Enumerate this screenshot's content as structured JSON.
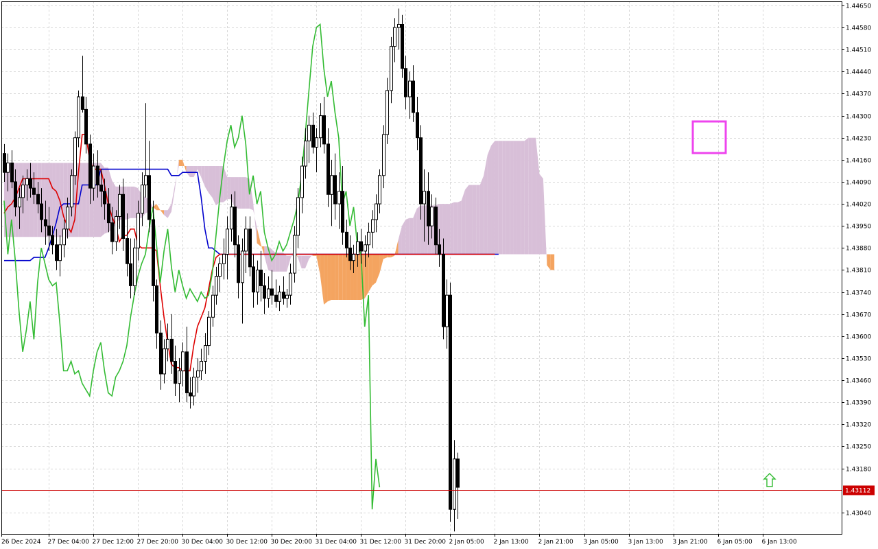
{
  "chart_data": {
    "type": "candlestick",
    "title": "",
    "x_labels": [
      "26 Dec 2024",
      "27 Dec 04:00",
      "27 Dec 12:00",
      "27 Dec 20:00",
      "30 Dec 04:00",
      "30 Dec 12:00",
      "30 Dec 20:00",
      "31 Dec 04:00",
      "31 Dec 12:00",
      "31 Dec 20:00",
      "2 Jan 05:00",
      "2 Jan 13:00",
      "2 Jan 21:00",
      "3 Jan 05:00",
      "3 Jan 13:00",
      "3 Jan 21:00",
      "6 Jan 05:00",
      "6 Jan 13:00"
    ],
    "y_labels": [
      "1.44650",
      "1.44580",
      "1.44510",
      "1.44440",
      "1.44370",
      "1.44300",
      "1.44230",
      "1.44160",
      "1.44090",
      "1.44020",
      "1.43950",
      "1.43880",
      "1.43810",
      "1.43740",
      "1.43670",
      "1.43600",
      "1.43530",
      "1.43460",
      "1.43390",
      "1.43320",
      "1.43250",
      "1.43180",
      "1.43040"
    ],
    "ylim": [
      1.42972,
      1.44663
    ],
    "current_price": "1.43112",
    "current_price_value": 1.43112,
    "candles": [
      [
        1.4418,
        1.4421,
        1.4409,
        1.4412
      ],
      [
        1.4412,
        1.4418,
        1.4406,
        1.4415
      ],
      [
        1.4415,
        1.4419,
        1.4407,
        1.4409
      ],
      [
        1.4409,
        1.4413,
        1.4398,
        1.4401
      ],
      [
        1.4401,
        1.4407,
        1.4394,
        1.4404
      ],
      [
        1.4404,
        1.4411,
        1.4399,
        1.4408
      ],
      [
        1.4408,
        1.4413,
        1.4403,
        1.441
      ],
      [
        1.441,
        1.4415,
        1.4404,
        1.4407
      ],
      [
        1.4407,
        1.4412,
        1.4402,
        1.4405
      ],
      [
        1.4405,
        1.4409,
        1.4399,
        1.4402
      ],
      [
        1.4402,
        1.4407,
        1.4393,
        1.4397
      ],
      [
        1.4397,
        1.4403,
        1.4389,
        1.4395
      ],
      [
        1.4395,
        1.4401,
        1.4387,
        1.4392
      ],
      [
        1.4392,
        1.4395,
        1.4386,
        1.4389
      ],
      [
        1.4389,
        1.4394,
        1.4381,
        1.4384
      ],
      [
        1.4384,
        1.4392,
        1.4379,
        1.4389
      ],
      [
        1.4389,
        1.4397,
        1.4385,
        1.4394
      ],
      [
        1.4394,
        1.4404,
        1.4391,
        1.4401
      ],
      [
        1.4401,
        1.4413,
        1.4398,
        1.4411
      ],
      [
        1.4411,
        1.4425,
        1.4408,
        1.4423
      ],
      [
        1.4423,
        1.4438,
        1.442,
        1.4436
      ],
      [
        1.4436,
        1.4449,
        1.4431,
        1.4432
      ],
      [
        1.4432,
        1.4436,
        1.4418,
        1.4421
      ],
      [
        1.4421,
        1.4424,
        1.4402,
        1.4407
      ],
      [
        1.4407,
        1.4418,
        1.4403,
        1.4414
      ],
      [
        1.4414,
        1.4419,
        1.4404,
        1.4408
      ],
      [
        1.4408,
        1.4413,
        1.4401,
        1.4406
      ],
      [
        1.4406,
        1.441,
        1.4397,
        1.4402
      ],
      [
        1.4402,
        1.4407,
        1.4393,
        1.4396
      ],
      [
        1.4396,
        1.4401,
        1.4386,
        1.439
      ],
      [
        1.439,
        1.44,
        1.4387,
        1.4398
      ],
      [
        1.4398,
        1.4408,
        1.4394,
        1.4405
      ],
      [
        1.4405,
        1.441,
        1.4387,
        1.4391
      ],
      [
        1.4391,
        1.4399,
        1.4379,
        1.4383
      ],
      [
        1.4383,
        1.4391,
        1.4372,
        1.4376
      ],
      [
        1.4376,
        1.4391,
        1.4373,
        1.4388
      ],
      [
        1.4388,
        1.4403,
        1.4384,
        1.4399
      ],
      [
        1.4399,
        1.4412,
        1.4395,
        1.4408
      ],
      [
        1.4408,
        1.4434,
        1.4404,
        1.4411
      ],
      [
        1.4411,
        1.4422,
        1.4393,
        1.4397
      ],
      [
        1.4397,
        1.4403,
        1.4371,
        1.4376
      ],
      [
        1.4376,
        1.4378,
        1.4356,
        1.4361
      ],
      [
        1.4361,
        1.4365,
        1.4343,
        1.4348
      ],
      [
        1.4348,
        1.4359,
        1.4345,
        1.4356
      ],
      [
        1.4356,
        1.4364,
        1.4352,
        1.4359
      ],
      [
        1.4359,
        1.4367,
        1.4348,
        1.4352
      ],
      [
        1.4352,
        1.4357,
        1.4341,
        1.4345
      ],
      [
        1.4345,
        1.4353,
        1.4339,
        1.4349
      ],
      [
        1.4349,
        1.4358,
        1.4344,
        1.4355
      ],
      [
        1.4355,
        1.4363,
        1.4339,
        1.4342
      ],
      [
        1.4342,
        1.4347,
        1.4337,
        1.4341
      ],
      [
        1.4341,
        1.435,
        1.4338,
        1.4347
      ],
      [
        1.4347,
        1.4353,
        1.4342,
        1.4349
      ],
      [
        1.4349,
        1.4356,
        1.4346,
        1.4352
      ],
      [
        1.4352,
        1.4361,
        1.4348,
        1.4357
      ],
      [
        1.4357,
        1.4368,
        1.4354,
        1.4366
      ],
      [
        1.4366,
        1.4376,
        1.4363,
        1.4373
      ],
      [
        1.4373,
        1.4382,
        1.437,
        1.4379
      ],
      [
        1.4379,
        1.4385,
        1.4374,
        1.4383
      ],
      [
        1.4383,
        1.4391,
        1.4378,
        1.4386
      ],
      [
        1.4386,
        1.4398,
        1.4378,
        1.4394
      ],
      [
        1.4394,
        1.4405,
        1.439,
        1.4401
      ],
      [
        1.4401,
        1.4406,
        1.4385,
        1.4389
      ],
      [
        1.4389,
        1.4392,
        1.4372,
        1.4377
      ],
      [
        1.4377,
        1.4391,
        1.4364,
        1.4387
      ],
      [
        1.4387,
        1.4398,
        1.438,
        1.4394
      ],
      [
        1.4394,
        1.4398,
        1.4379,
        1.4382
      ],
      [
        1.4382,
        1.4386,
        1.4369,
        1.4374
      ],
      [
        1.4374,
        1.4384,
        1.437,
        1.4381
      ],
      [
        1.4381,
        1.4387,
        1.4371,
        1.4376
      ],
      [
        1.4376,
        1.438,
        1.4367,
        1.4372
      ],
      [
        1.4372,
        1.4379,
        1.4369,
        1.4375
      ],
      [
        1.4375,
        1.4381,
        1.437,
        1.4373
      ],
      [
        1.4373,
        1.4378,
        1.4369,
        1.4371
      ],
      [
        1.4371,
        1.4376,
        1.4368,
        1.4374
      ],
      [
        1.4374,
        1.4379,
        1.437,
        1.4372
      ],
      [
        1.4372,
        1.4375,
        1.4369,
        1.4373
      ],
      [
        1.4373,
        1.4383,
        1.437,
        1.438
      ],
      [
        1.438,
        1.4395,
        1.4377,
        1.4392
      ],
      [
        1.4392,
        1.4407,
        1.4388,
        1.4404
      ],
      [
        1.4404,
        1.4417,
        1.4399,
        1.4414
      ],
      [
        1.4414,
        1.4426,
        1.441,
        1.4422
      ],
      [
        1.4422,
        1.443,
        1.4415,
        1.4427
      ],
      [
        1.4427,
        1.4431,
        1.4418,
        1.442
      ],
      [
        1.442,
        1.4426,
        1.4412,
        1.4423
      ],
      [
        1.4423,
        1.4434,
        1.442,
        1.443
      ],
      [
        1.443,
        1.4436,
        1.4418,
        1.4421
      ],
      [
        1.4421,
        1.4426,
        1.4401,
        1.4405
      ],
      [
        1.4405,
        1.4416,
        1.4395,
        1.4411
      ],
      [
        1.4411,
        1.4418,
        1.4397,
        1.4402
      ],
      [
        1.4402,
        1.4412,
        1.4394,
        1.4406
      ],
      [
        1.4406,
        1.4414,
        1.4389,
        1.4393
      ],
      [
        1.4393,
        1.4397,
        1.4385,
        1.4388
      ],
      [
        1.4388,
        1.4392,
        1.4381,
        1.4384
      ],
      [
        1.4384,
        1.4389,
        1.438,
        1.4386
      ],
      [
        1.4386,
        1.4393,
        1.4382,
        1.439
      ],
      [
        1.439,
        1.4394,
        1.4383,
        1.4387
      ],
      [
        1.4387,
        1.4392,
        1.4382,
        1.4389
      ],
      [
        1.4389,
        1.4396,
        1.4385,
        1.4393
      ],
      [
        1.4393,
        1.44,
        1.4388,
        1.4397
      ],
      [
        1.4397,
        1.4405,
        1.4393,
        1.4402
      ],
      [
        1.4402,
        1.4413,
        1.4399,
        1.4411
      ],
      [
        1.4411,
        1.4427,
        1.4407,
        1.4424
      ],
      [
        1.4424,
        1.4442,
        1.4421,
        1.4438
      ],
      [
        1.4438,
        1.4455,
        1.4434,
        1.4452
      ],
      [
        1.4452,
        1.4461,
        1.4447,
        1.4458
      ],
      [
        1.4458,
        1.4464,
        1.4451,
        1.4459
      ],
      [
        1.4459,
        1.4462,
        1.4442,
        1.4445
      ],
      [
        1.4445,
        1.4449,
        1.4432,
        1.4436
      ],
      [
        1.4436,
        1.4444,
        1.4429,
        1.4441
      ],
      [
        1.4441,
        1.4446,
        1.4428,
        1.4431
      ],
      [
        1.4431,
        1.4436,
        1.4419,
        1.4423
      ],
      [
        1.4423,
        1.4427,
        1.4397,
        1.4402
      ],
      [
        1.4402,
        1.4413,
        1.439,
        1.4406
      ],
      [
        1.4406,
        1.4412,
        1.4389,
        1.4395
      ],
      [
        1.4395,
        1.4405,
        1.4391,
        1.4401
      ],
      [
        1.4401,
        1.4404,
        1.4386,
        1.4389
      ],
      [
        1.4389,
        1.4394,
        1.4382,
        1.4386
      ],
      [
        1.4386,
        1.4391,
        1.4359,
        1.4363
      ],
      [
        1.4363,
        1.4378,
        1.4356,
        1.4373
      ],
      [
        1.4373,
        1.4377,
        1.4301,
        1.4305
      ],
      [
        1.4305,
        1.4327,
        1.4298,
        1.4321
      ],
      [
        1.4321,
        1.4323,
        1.4302,
        1.4312
      ]
    ],
    "series": [
      {
        "name": "",
        "color": "#0000cc",
        "values": [
          1.4384,
          1.4384,
          1.4384,
          1.4384,
          1.4384,
          1.4384,
          1.4384,
          1.4384,
          1.4385,
          1.4385,
          1.4385,
          1.4385,
          1.4388,
          1.4392,
          1.4396,
          1.4401,
          1.4402,
          1.4402,
          1.4402,
          1.4402,
          1.4402,
          1.4408,
          1.4408,
          1.4408,
          1.4408,
          1.4408,
          1.4413,
          1.4413,
          1.4413,
          1.4413,
          1.4413,
          1.4413,
          1.4413,
          1.4413,
          1.4413,
          1.4413,
          1.4413,
          1.4413,
          1.4413,
          1.4413,
          1.4413,
          1.4413,
          1.4413,
          1.4413,
          1.4413,
          1.4411,
          1.4411,
          1.4411,
          1.4412,
          1.4412,
          1.4412,
          1.4412,
          1.4412,
          1.4404,
          1.4394,
          1.4388,
          1.4388,
          1.4387,
          1.4386,
          1.4386,
          1.4386,
          1.4386,
          1.4386,
          1.4386,
          1.4386,
          1.4386,
          1.4386,
          1.4386,
          1.4386,
          1.4386,
          1.4386,
          1.4386,
          1.4386,
          1.4386,
          1.4386,
          1.4386,
          1.4386,
          1.4386,
          1.4386,
          1.4386,
          1.4386,
          1.4386,
          1.4386,
          1.4386,
          1.4386,
          1.4386,
          1.4386,
          1.4386,
          1.4386,
          1.4386,
          1.4386,
          1.4386,
          1.4386,
          1.4386,
          1.4386,
          1.4386,
          1.4386,
          1.4386,
          1.4386,
          1.4386,
          1.4386,
          1.4386,
          1.4386,
          1.4386,
          1.4386,
          1.4386,
          1.4386,
          1.4386,
          1.4386,
          1.4386,
          1.4386,
          1.4386,
          1.4386,
          1.4386,
          1.4386,
          1.4386,
          1.4386,
          1.4386,
          1.4386,
          1.4386,
          1.4386,
          1.4386,
          1.4386,
          1.4386,
          1.4386,
          1.4386,
          1.4386,
          1.4386,
          1.4386,
          1.4386,
          1.4386,
          1.4386,
          1.4386,
          1.4386
        ]
      },
      {
        "name": "",
        "color": "#dd0000",
        "values": [
          1.4399,
          1.4401,
          1.4402,
          1.4404,
          1.4407,
          1.441,
          1.441,
          1.441,
          1.441,
          1.441,
          1.441,
          1.441,
          1.441,
          1.4407,
          1.4406,
          1.4403,
          1.4398,
          1.4395,
          1.4393,
          1.4397,
          1.4412,
          1.4424,
          1.4424,
          1.4416,
          1.4413,
          1.4413,
          1.4413,
          1.4408,
          1.4402,
          1.4398,
          1.4395,
          1.439,
          1.4392,
          1.4392,
          1.4394,
          1.4394,
          1.4389,
          1.4388,
          1.4388,
          1.4388,
          1.4388,
          1.4387,
          1.4376,
          1.4366,
          1.4358,
          1.4351,
          1.435,
          1.435,
          1.4349,
          1.4349,
          1.4349,
          1.4357,
          1.4363,
          1.4366,
          1.4369,
          1.4375,
          1.4381,
          1.4385,
          1.4386,
          1.4386,
          1.4386,
          1.4386,
          1.4386,
          1.4386,
          1.4386,
          1.4386,
          1.4386,
          1.4386,
          1.4386,
          1.4386,
          1.4386,
          1.4386,
          1.4386,
          1.4386,
          1.4386,
          1.4386,
          1.4386,
          1.4386,
          1.4386,
          1.4386,
          1.4386,
          1.4386,
          1.4386,
          1.4386,
          1.4386,
          1.4386,
          1.4386,
          1.4386,
          1.4386,
          1.4386,
          1.4386,
          1.4386,
          1.4386,
          1.4386,
          1.4386,
          1.4386,
          1.4386,
          1.4386,
          1.4386,
          1.4386,
          1.4386,
          1.4386,
          1.4386,
          1.4386,
          1.4386,
          1.4386,
          1.4386,
          1.4386,
          1.4386,
          1.4386,
          1.4386,
          1.4386,
          1.4386,
          1.4386,
          1.4386,
          1.4386,
          1.4386,
          1.4386,
          1.4386,
          1.4386,
          1.4386,
          1.4386,
          1.4386,
          1.4386,
          1.4386,
          1.4386,
          1.4386,
          1.4386,
          1.4386,
          1.4386,
          1.4386,
          1.4386,
          1.4386
        ]
      },
      {
        "name": "",
        "color": "#33bb33",
        "values": [
          1.4403,
          1.4386,
          1.4397,
          1.4384,
          1.4368,
          1.4355,
          1.4362,
          1.4371,
          1.4359,
          1.4377,
          1.4388,
          1.4383,
          1.4378,
          1.4376,
          1.4377,
          1.4364,
          1.4349,
          1.4349,
          1.4352,
          1.4348,
          1.4349,
          1.4345,
          1.4343,
          1.4341,
          1.4349,
          1.4355,
          1.4358,
          1.4349,
          1.4342,
          1.4341,
          1.4347,
          1.4349,
          1.4352,
          1.4357,
          1.4366,
          1.4373,
          1.4379,
          1.4383,
          1.4386,
          1.4394,
          1.4401,
          1.4389,
          1.4377,
          1.4387,
          1.4394,
          1.4382,
          1.4374,
          1.4381,
          1.4376,
          1.4372,
          1.4375,
          1.4373,
          1.4371,
          1.4374,
          1.4372,
          1.4373,
          1.438,
          1.4392,
          1.4404,
          1.4414,
          1.4422,
          1.4427,
          1.442,
          1.4423,
          1.443,
          1.4421,
          1.4405,
          1.4411,
          1.4402,
          1.4406,
          1.4393,
          1.4388,
          1.4384,
          1.4386,
          1.439,
          1.4387,
          1.4389,
          1.4393,
          1.4397,
          1.4402,
          1.4411,
          1.4424,
          1.4438,
          1.4452,
          1.4458,
          1.4459,
          1.4445,
          1.4436,
          1.4441,
          1.4431,
          1.4423,
          1.4402,
          1.4406,
          1.4395,
          1.4401,
          1.4389,
          1.4386,
          1.4363,
          1.4373,
          1.4305,
          1.4321,
          1.4312
        ]
      }
    ],
    "cloud": {
      "colors": {
        "bullish": "#f4a460",
        "bearish": "#d8bfd8"
      }
    }
  }
}
